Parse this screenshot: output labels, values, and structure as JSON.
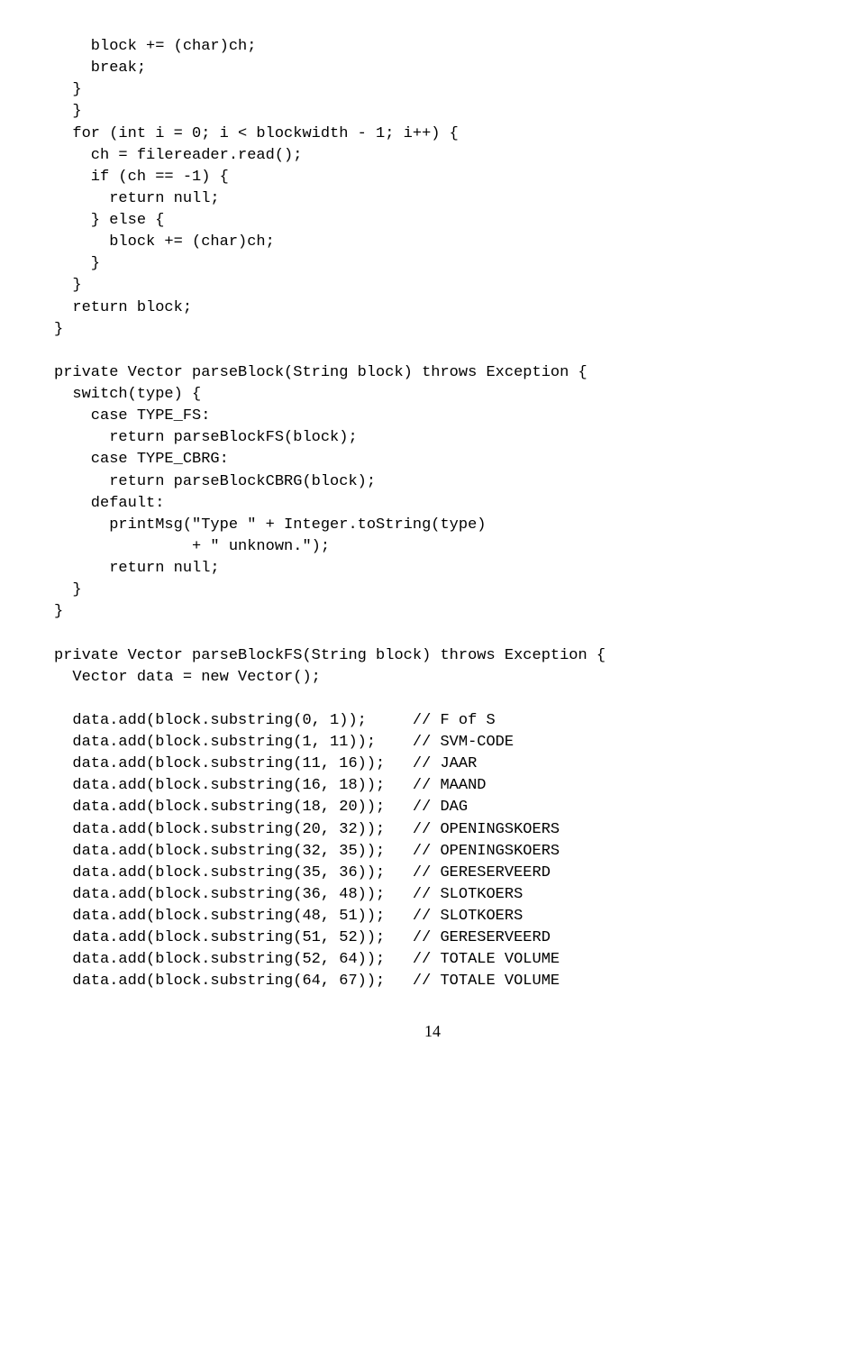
{
  "code": "    block += (char)ch;\n    break;\n  }\n  }\n  for (int i = 0; i < blockwidth - 1; i++) {\n    ch = filereader.read();\n    if (ch == -1) {\n      return null;\n    } else {\n      block += (char)ch;\n    }\n  }\n  return block;\n}\n\nprivate Vector parseBlock(String block) throws Exception {\n  switch(type) {\n    case TYPE_FS:\n      return parseBlockFS(block);\n    case TYPE_CBRG:\n      return parseBlockCBRG(block);\n    default:\n      printMsg(\"Type \" + Integer.toString(type)\n               + \" unknown.\");\n      return null;\n  }\n}\n\nprivate Vector parseBlockFS(String block) throws Exception {\n  Vector data = new Vector();\n\n  data.add(block.substring(0, 1));     // F of S\n  data.add(block.substring(1, 11));    // SVM-CODE\n  data.add(block.substring(11, 16));   // JAAR\n  data.add(block.substring(16, 18));   // MAAND\n  data.add(block.substring(18, 20));   // DAG\n  data.add(block.substring(20, 32));   // OPENINGSKOERS\n  data.add(block.substring(32, 35));   // OPENINGSKOERS\n  data.add(block.substring(35, 36));   // GERESERVEERD\n  data.add(block.substring(36, 48));   // SLOTKOERS\n  data.add(block.substring(48, 51));   // SLOTKOERS\n  data.add(block.substring(51, 52));   // GERESERVEERD\n  data.add(block.substring(52, 64));   // TOTALE VOLUME\n  data.add(block.substring(64, 67));   // TOTALE VOLUME",
  "page_number": "14"
}
